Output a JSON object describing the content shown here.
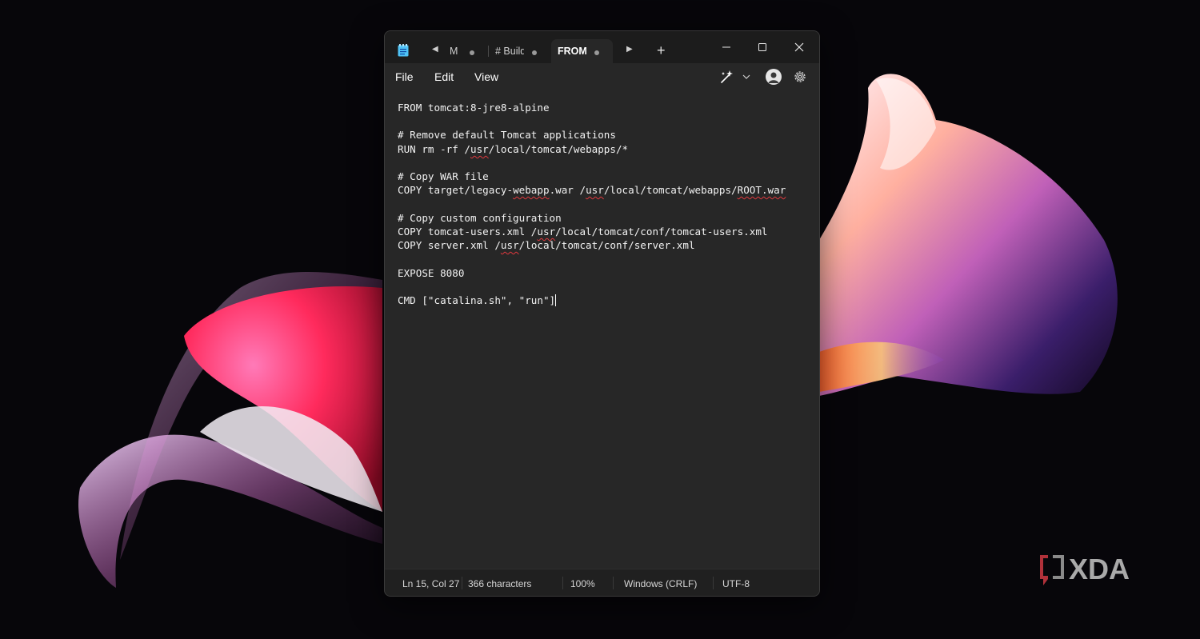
{
  "app": {
    "tabs": [
      {
        "label": "M",
        "active": false
      },
      {
        "label": "# Build",
        "active": false
      },
      {
        "label": "FROM",
        "active": true
      }
    ],
    "menu": [
      "File",
      "Edit",
      "View"
    ]
  },
  "editor": {
    "lines": [
      "FROM tomcat:8-jre8-alpine",
      "",
      "# Remove default Tomcat applications",
      "RUN rm -rf /usr/local/tomcat/webapps/*",
      "",
      "# Copy WAR file",
      "COPY target/legacy-webapp.war /usr/local/tomcat/webapps/ROOT.war",
      "",
      "# Copy custom configuration",
      "COPY tomcat-users.xml /usr/local/tomcat/conf/tomcat-users.xml",
      "COPY server.xml /usr/local/tomcat/conf/server.xml",
      "",
      "EXPOSE 8080",
      "",
      "CMD [\"catalina.sh\", \"run\"]"
    ],
    "misspelled": [
      "usr",
      "webapp",
      "ROOT.war"
    ]
  },
  "status": {
    "position": "Ln 15, Col 27",
    "characters": "366 characters",
    "zoom": "100%",
    "line_ending": "Windows (CRLF)",
    "encoding": "UTF-8"
  },
  "watermark": "XDA",
  "icons": [
    "notepad-icon",
    "tab-scroll-left-icon",
    "tab-scroll-right-icon",
    "plus-icon",
    "minimize-icon",
    "maximize-icon",
    "close-icon",
    "copilot-icon",
    "chevron-down-icon",
    "avatar-icon",
    "gear-icon"
  ],
  "colors": {
    "editor_bg": "#272727",
    "titlebar_bg": "#1c1c1c",
    "statusbar_bg": "#202020",
    "squiggle": "#e0383e",
    "wallpaper_bg": "#07060a"
  }
}
